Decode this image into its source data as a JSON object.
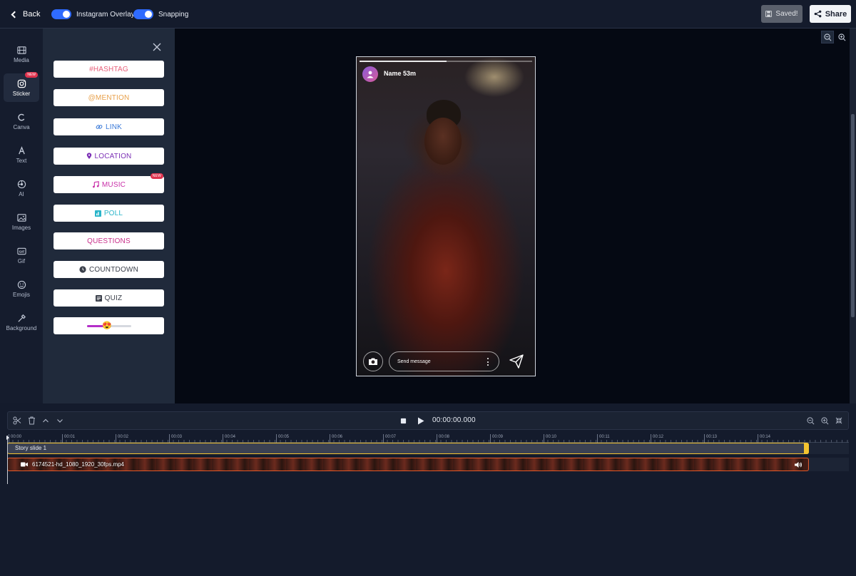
{
  "topbar": {
    "back_label": "Back",
    "toggles": [
      {
        "label": "Instagram Overlay",
        "on": true
      },
      {
        "label": "Snapping",
        "on": true
      }
    ],
    "saved_label": "Saved!",
    "share_label": "Share"
  },
  "rail": {
    "items": [
      {
        "label": "Media",
        "icon": "film-icon"
      },
      {
        "label": "Sticker",
        "icon": "instagram-icon",
        "badge": "NEW",
        "active": true
      },
      {
        "label": "Canva",
        "icon": "canva-icon"
      },
      {
        "label": "Text",
        "icon": "text-icon"
      },
      {
        "label": "AI",
        "icon": "ai-icon"
      },
      {
        "label": "Images",
        "icon": "image-icon"
      },
      {
        "label": "Gif",
        "icon": "gif-icon"
      },
      {
        "label": "Emojis",
        "icon": "smiley-icon"
      },
      {
        "label": "Background",
        "icon": "eyedropper-icon"
      }
    ]
  },
  "stickers": {
    "items": [
      {
        "label": "#HASHTAG",
        "color": "#e8607a"
      },
      {
        "label": "@MENTION",
        "color": "#e8a04a"
      },
      {
        "label": "LINK",
        "color": "#3b7ad8",
        "icon": "link-icon"
      },
      {
        "label": "LOCATION",
        "color": "#7b2fb5",
        "icon": "location-pin-icon"
      },
      {
        "label": "MUSIC",
        "color": "#c92fa8",
        "icon": "music-note-icon",
        "badge": "NEW"
      },
      {
        "label": "POLL",
        "color": "#2ab5c9",
        "icon": "poll-icon"
      },
      {
        "label": "QUESTIONS",
        "color": "#c92f8a"
      },
      {
        "label": "COUNTDOWN",
        "color": "#3a3f4a",
        "icon": "clock-icon"
      },
      {
        "label": "QUIZ",
        "color": "#3a3f4a",
        "icon": "quiz-icon"
      }
    ],
    "slider_emoji": "😍",
    "slider_level": 0.45
  },
  "story": {
    "name": "Name 53m",
    "message_placeholder": "Send message",
    "progress": 0.5
  },
  "timeline": {
    "time": "00:00:00.000",
    "ticks": [
      "00:00",
      "00:01",
      "00:02",
      "00:03",
      "00:04",
      "00:05",
      "00:06",
      "00:07",
      "00:08",
      "00:09",
      "00:10",
      "00:11",
      "00:12",
      "00:13",
      "00:14"
    ],
    "slide_label": "Story slide 1",
    "video_label": "6174521-hd_1080_1920_30fps.mp4"
  },
  "colors": {
    "accent": "#2f6bff",
    "slide_border": "#f4c430",
    "video_border": "#e25a2a"
  }
}
